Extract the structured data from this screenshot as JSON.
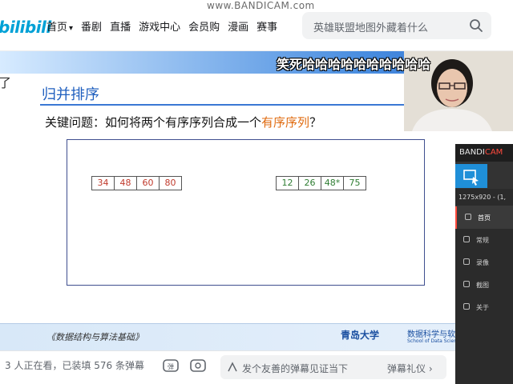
{
  "watermark": "www.BANDICAM.com",
  "header": {
    "logo": "bilibili",
    "nav": [
      "首页",
      "番剧",
      "直播",
      "游戏中心",
      "会员购",
      "漫画",
      "赛事"
    ],
    "search_placeholder": "英雄联盟地图外藏着什么"
  },
  "video": {
    "danmaku": "笑死哈哈哈哈哈哈哈哈哈哈",
    "left_mark": "了",
    "slide": {
      "title": "归并排序",
      "question_prefix": "关键问题：如何将两个有序序列合成一个",
      "question_highlight": "有序序列",
      "question_suffix": "？",
      "array_a": [
        "34",
        "48",
        "60",
        "80"
      ],
      "array_b": [
        "12",
        "26",
        "48*",
        "75"
      ],
      "footer_book": "《数据结构与算法基础》",
      "footer_university": "青岛大学",
      "footer_department": "数据科学与软件",
      "footer_department_en": "School of Data Science and S"
    }
  },
  "bandicam": {
    "title_prefix": "BANDI",
    "title_suffix": "CAM",
    "size": "1275x920 - (1,",
    "menu": [
      "首页",
      "常规",
      "录像",
      "截图",
      "关于"
    ]
  },
  "bottom_bar": {
    "viewers_text": "3 人正在看，已装填 576 条弹幕",
    "danmaku_placeholder": "发个友善的弹幕见证当下",
    "etiquette": "弹幕礼仪 ›"
  },
  "colors": {
    "bilibili_blue": "#00a1d6",
    "slide_title_blue": "#1f5fbf",
    "highlight_orange": "#e06b10",
    "array_a_red": "#c0392b",
    "array_b_green": "#2e7d32",
    "bandicam_blue": "#1f8fd8"
  }
}
